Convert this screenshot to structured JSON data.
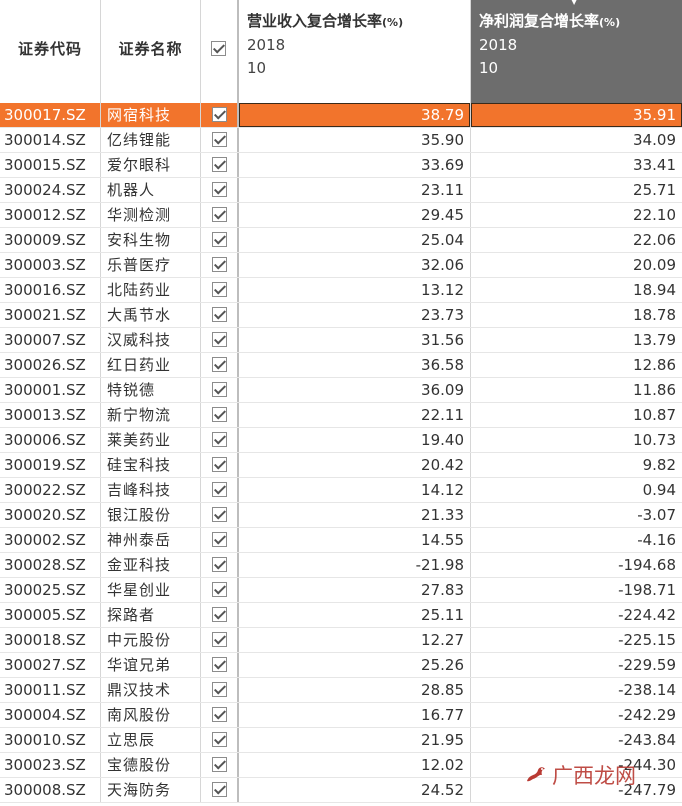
{
  "table": {
    "columns": {
      "code": "证券代码",
      "name": "证券名称",
      "revenue": {
        "title": "营业收入复合增长率",
        "unit": "(%)",
        "year": "2018",
        "period": "10"
      },
      "profit": {
        "title": "净利润复合增长率",
        "unit": "(%)",
        "year": "2018",
        "period": "10"
      }
    },
    "sorted_column": "profit",
    "sort_direction": "descending",
    "selected_row": 0,
    "rows": [
      {
        "code": "300017.SZ",
        "name": "网宿科技",
        "revenue": "38.79",
        "profit": "35.91"
      },
      {
        "code": "300014.SZ",
        "name": "亿纬锂能",
        "revenue": "35.90",
        "profit": "34.09"
      },
      {
        "code": "300015.SZ",
        "name": "爱尔眼科",
        "revenue": "33.69",
        "profit": "33.41"
      },
      {
        "code": "300024.SZ",
        "name": "机器人",
        "revenue": "23.11",
        "profit": "25.71"
      },
      {
        "code": "300012.SZ",
        "name": "华测检测",
        "revenue": "29.45",
        "profit": "22.10"
      },
      {
        "code": "300009.SZ",
        "name": "安科生物",
        "revenue": "25.04",
        "profit": "22.06"
      },
      {
        "code": "300003.SZ",
        "name": "乐普医疗",
        "revenue": "32.06",
        "profit": "20.09"
      },
      {
        "code": "300016.SZ",
        "name": "北陆药业",
        "revenue": "13.12",
        "profit": "18.94"
      },
      {
        "code": "300021.SZ",
        "name": "大禹节水",
        "revenue": "23.73",
        "profit": "18.78"
      },
      {
        "code": "300007.SZ",
        "name": "汉威科技",
        "revenue": "31.56",
        "profit": "13.79"
      },
      {
        "code": "300026.SZ",
        "name": "红日药业",
        "revenue": "36.58",
        "profit": "12.86"
      },
      {
        "code": "300001.SZ",
        "name": "特锐德",
        "revenue": "36.09",
        "profit": "11.86"
      },
      {
        "code": "300013.SZ",
        "name": "新宁物流",
        "revenue": "22.11",
        "profit": "10.87"
      },
      {
        "code": "300006.SZ",
        "name": "莱美药业",
        "revenue": "19.40",
        "profit": "10.73"
      },
      {
        "code": "300019.SZ",
        "name": "硅宝科技",
        "revenue": "20.42",
        "profit": "9.82"
      },
      {
        "code": "300022.SZ",
        "name": "吉峰科技",
        "revenue": "14.12",
        "profit": "0.94"
      },
      {
        "code": "300020.SZ",
        "name": "银江股份",
        "revenue": "21.33",
        "profit": "-3.07"
      },
      {
        "code": "300002.SZ",
        "name": "神州泰岳",
        "revenue": "14.55",
        "profit": "-4.16"
      },
      {
        "code": "300028.SZ",
        "name": "金亚科技",
        "revenue": "-21.98",
        "profit": "-194.68"
      },
      {
        "code": "300025.SZ",
        "name": "华星创业",
        "revenue": "27.83",
        "profit": "-198.71"
      },
      {
        "code": "300005.SZ",
        "name": "探路者",
        "revenue": "25.11",
        "profit": "-224.42"
      },
      {
        "code": "300018.SZ",
        "name": "中元股份",
        "revenue": "12.27",
        "profit": "-225.15"
      },
      {
        "code": "300027.SZ",
        "name": "华谊兄弟",
        "revenue": "25.26",
        "profit": "-229.59"
      },
      {
        "code": "300011.SZ",
        "name": "鼎汉技术",
        "revenue": "28.85",
        "profit": "-238.14"
      },
      {
        "code": "300004.SZ",
        "name": "南风股份",
        "revenue": "16.77",
        "profit": "-242.29"
      },
      {
        "code": "300010.SZ",
        "name": "立思辰",
        "revenue": "21.95",
        "profit": "-243.84"
      },
      {
        "code": "300023.SZ",
        "name": "宝德股份",
        "revenue": "12.02",
        "profit": "-244.30"
      },
      {
        "code": "300008.SZ",
        "name": "天海防务",
        "revenue": "24.52",
        "profit": "-247.79"
      }
    ]
  },
  "watermark": {
    "text": "广西龙网",
    "color": "#b93a33"
  },
  "colors": {
    "selected_row": "#f2742c",
    "sorted_header": "#6d6d6d"
  },
  "icons": {
    "checkbox": "checkbox-checked-icon",
    "sort": "sort-descending-icon",
    "watermark": "dragon-logo-icon"
  }
}
